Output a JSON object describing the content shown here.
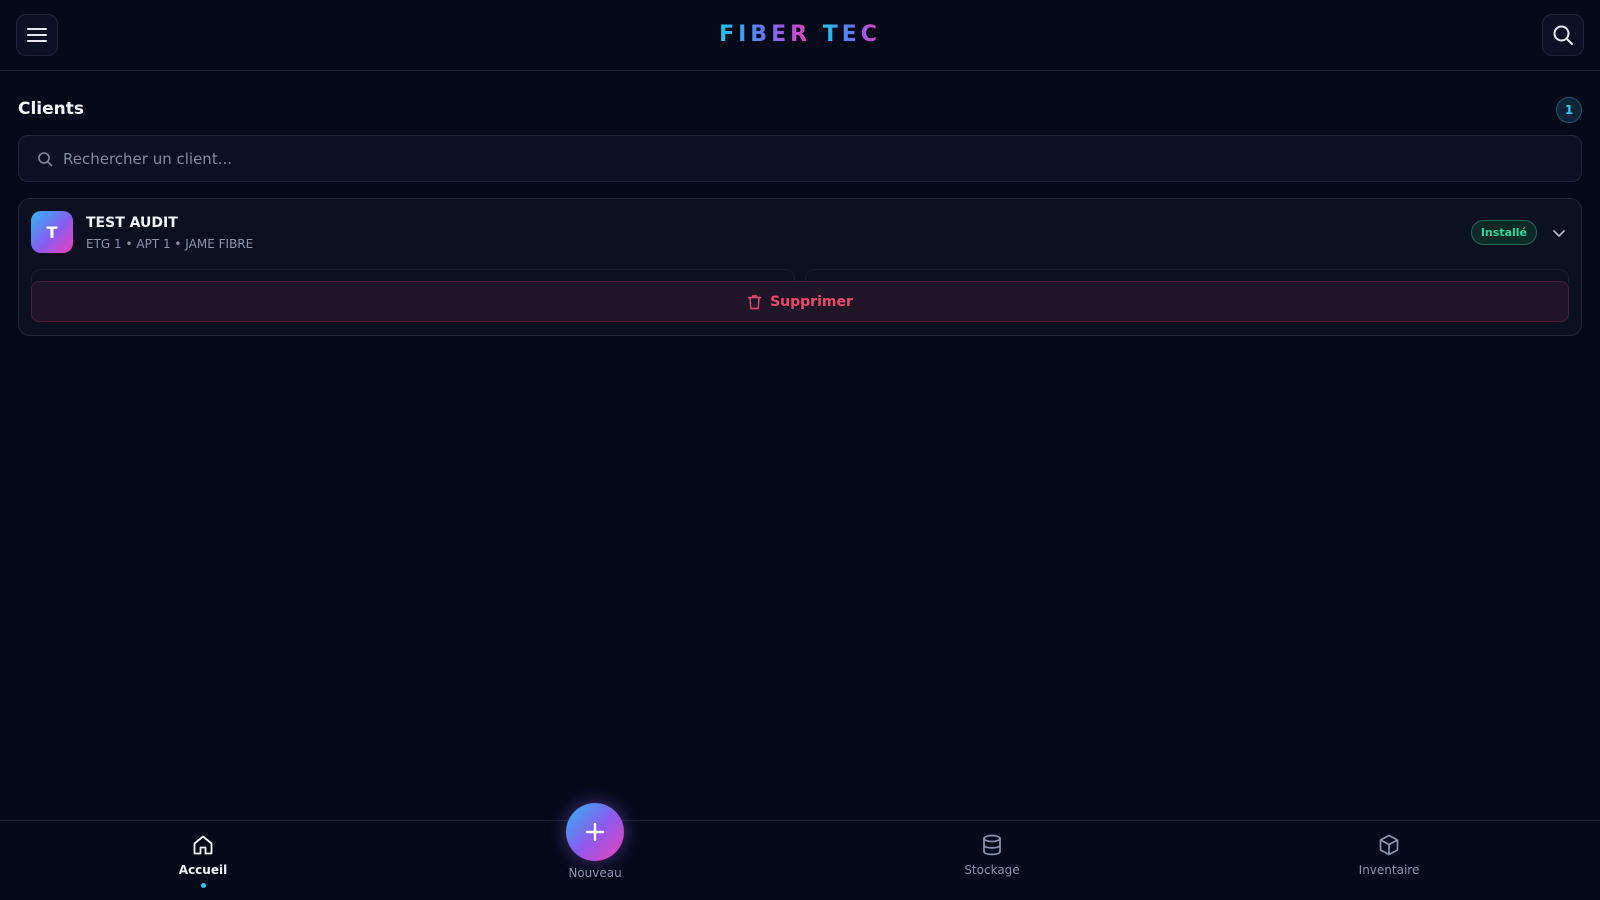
{
  "header": {
    "logo_part1": "FIBER",
    "logo_part2": "TEC",
    "menu_icon": "hamburger-menu-icon",
    "search_icon": "search-icon"
  },
  "clients": {
    "title": "Clients",
    "count": "1",
    "search_placeholder": "Rechercher un client...",
    "items": [
      {
        "initial": "T",
        "name": "TEST AUDIT",
        "meta": "ETG 1 • APT 1 • JAME FIBRE",
        "status": "Installé",
        "delete_label": "Supprimer"
      }
    ]
  },
  "bottom_nav": {
    "home": "Accueil",
    "new": "Nouveau",
    "storage": "Stockage",
    "inventory": "Inventaire"
  },
  "colors": {
    "background": "#050a1a",
    "accent_cyan": "#29c8f2",
    "accent_magenta": "#ee3fb6",
    "status_green": "#2fd79b",
    "danger": "#ee4a6d"
  }
}
